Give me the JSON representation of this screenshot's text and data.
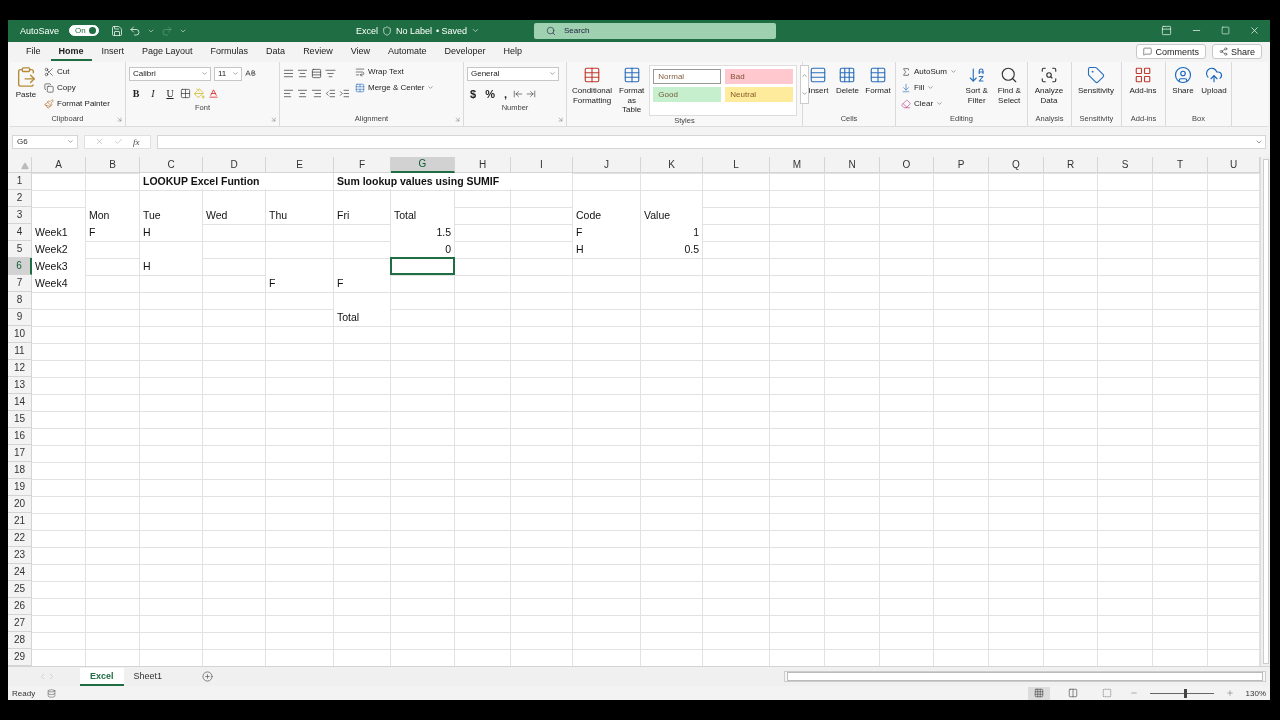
{
  "title_bar": {
    "autosave_label": "AutoSave",
    "autosave_on": true,
    "toggle_text": "On",
    "app": "Excel",
    "label": "No Label",
    "status": "• Saved",
    "search": {
      "placeholder": "Search"
    }
  },
  "menu_tabs": [
    {
      "label": "File",
      "selected": false
    },
    {
      "label": "Home",
      "selected": true
    },
    {
      "label": "Insert",
      "selected": false
    },
    {
      "label": "Page Layout",
      "selected": false
    },
    {
      "label": "Formulas",
      "selected": false
    },
    {
      "label": "Data",
      "selected": false
    },
    {
      "label": "Review",
      "selected": false
    },
    {
      "label": "View",
      "selected": false
    },
    {
      "label": "Automate",
      "selected": false
    },
    {
      "label": "Developer",
      "selected": false
    },
    {
      "label": "Help",
      "selected": false
    }
  ],
  "comments_button": "Comments",
  "share_button": "Share",
  "ribbon": {
    "clipboard": {
      "paste": "Paste",
      "cut": "Cut",
      "copy": "Copy",
      "format_painter": "Format Painter",
      "label": "Clipboard"
    },
    "font": {
      "name": "Calibri",
      "size": "11",
      "bold": "B",
      "italic": "I",
      "underline": "U",
      "label": "Font"
    },
    "alignment": {
      "wrap": "Wrap Text",
      "merge": "Merge & Center",
      "label": "Alignment"
    },
    "number": {
      "format": "General",
      "currency": "$",
      "percent": "%",
      "comma": ",",
      "label": "Number"
    },
    "styles": {
      "conditional": "Conditional Formatting",
      "format_table": "Format as Table",
      "items": [
        {
          "label": "Normal",
          "color": "#ffffff"
        },
        {
          "label": "Bad",
          "color": "#ffc7ce"
        },
        {
          "label": "Good",
          "color": "#c6efce"
        },
        {
          "label": "Neutral",
          "color": "#ffeb9c"
        }
      ],
      "label": "Styles"
    },
    "cells": {
      "buttons": [
        "Insert",
        "Delete",
        "Format"
      ],
      "label": "Cells"
    },
    "editing": {
      "autosum": "AutoSum",
      "fill": "Fill",
      "clear": "Clear",
      "sort": "Sort & Filter",
      "find": "Find & Select",
      "label": "Editing"
    },
    "analysis": {
      "button": "Analyze Data",
      "label": "Analysis"
    },
    "sensitivity": {
      "button": "Sensitivity",
      "label": "Sensitivity"
    },
    "addins": {
      "button": "Add-ins",
      "label": "Add-ins"
    },
    "box": {
      "share": "Share",
      "upload": "Upload",
      "label": "Box"
    }
  },
  "formula_bar": {
    "name_box": "G6",
    "fx": "fx"
  },
  "sheet": {
    "columns": [
      {
        "letter": "A",
        "selected": false
      },
      {
        "letter": "B",
        "selected": false
      },
      {
        "letter": "C",
        "selected": false
      },
      {
        "letter": "D",
        "selected": false
      },
      {
        "letter": "E",
        "selected": false
      },
      {
        "letter": "F",
        "selected": false
      },
      {
        "letter": "G",
        "selected": true
      },
      {
        "letter": "H",
        "selected": false
      },
      {
        "letter": "I",
        "selected": false
      },
      {
        "letter": "J",
        "selected": false
      },
      {
        "letter": "K",
        "selected": false
      },
      {
        "letter": "L",
        "selected": false
      },
      {
        "letter": "M",
        "selected": false
      },
      {
        "letter": "N",
        "selected": false
      },
      {
        "letter": "O",
        "selected": false
      },
      {
        "letter": "P",
        "selected": false
      },
      {
        "letter": "Q",
        "selected": false
      },
      {
        "letter": "R",
        "selected": false
      },
      {
        "letter": "S",
        "selected": false
      },
      {
        "letter": "T",
        "selected": false
      },
      {
        "letter": "U",
        "selected": false
      }
    ],
    "rows": [
      {
        "number": "1",
        "selected": false,
        "cells": [
          null,
          null,
          {
            "kind": "text",
            "text": "LOOKUP Excel Funtion",
            "bold": true,
            "selected": false
          },
          null,
          null,
          {
            "kind": "text",
            "text": "Sum lookup values using SUMIF",
            "bold": true,
            "selected": false
          }
        ]
      },
      {
        "number": "2",
        "selected": false
      },
      {
        "number": "3",
        "selected": false,
        "cells": [
          null,
          {
            "kind": "text",
            "text": "Mon",
            "bold": false,
            "selected": false
          },
          {
            "kind": "text",
            "text": "Tue",
            "bold": false,
            "selected": false
          },
          {
            "kind": "text",
            "text": "Wed",
            "bold": false,
            "selected": false
          },
          {
            "kind": "text",
            "text": "Thu",
            "bold": false,
            "selected": false
          },
          {
            "kind": "text",
            "text": "Fri",
            "bold": false,
            "selected": false
          },
          {
            "kind": "text",
            "text": "Total",
            "bold": false,
            "selected": false
          },
          null,
          null,
          {
            "kind": "text",
            "text": "Code",
            "bold": false,
            "selected": false
          },
          {
            "kind": "text",
            "text": "Value",
            "bold": false,
            "selected": false
          }
        ]
      },
      {
        "number": "4",
        "selected": false,
        "cells": [
          {
            "kind": "text",
            "text": "Week1",
            "bold": false,
            "selected": false
          },
          {
            "kind": "text",
            "text": "F",
            "bold": false,
            "selected": false
          },
          {
            "kind": "text",
            "text": "H",
            "bold": false,
            "selected": false
          },
          null,
          null,
          null,
          {
            "kind": "number",
            "text": "1.5",
            "bold": false,
            "selected": false
          },
          null,
          null,
          {
            "kind": "text",
            "text": "F",
            "bold": false,
            "selected": false
          },
          {
            "kind": "number",
            "text": "1",
            "bold": false,
            "selected": false
          }
        ]
      },
      {
        "number": "5",
        "selected": false,
        "cells": [
          {
            "kind": "text",
            "text": "Week2",
            "bold": false,
            "selected": false
          },
          null,
          null,
          null,
          null,
          null,
          {
            "kind": "number",
            "text": "0",
            "bold": false,
            "selected": false
          },
          null,
          null,
          {
            "kind": "text",
            "text": "H",
            "bold": false,
            "selected": false
          },
          {
            "kind": "number",
            "text": "0.5",
            "bold": false,
            "selected": false
          }
        ]
      },
      {
        "number": "6",
        "selected": true,
        "cells": [
          {
            "kind": "text",
            "text": "Week3",
            "bold": false,
            "selected": false
          },
          null,
          {
            "kind": "text",
            "text": "H",
            "bold": false,
            "selected": false
          },
          null,
          null,
          null,
          {
            "kind": "empty",
            "selected": true
          }
        ]
      },
      {
        "number": "7",
        "selected": false,
        "cells": [
          {
            "kind": "text",
            "text": "Week4",
            "bold": false,
            "selected": false
          },
          null,
          null,
          null,
          {
            "kind": "text",
            "text": "F",
            "bold": false,
            "selected": false
          },
          {
            "kind": "text",
            "text": "F",
            "bold": false,
            "selected": false
          }
        ]
      },
      {
        "number": "8",
        "selected": false
      },
      {
        "number": "9",
        "selected": false,
        "cells": [
          null,
          null,
          null,
          null,
          null,
          {
            "kind": "text",
            "text": "Total",
            "bold": false,
            "selected": false
          }
        ]
      },
      {
        "number": "10",
        "selected": false
      },
      {
        "number": "11",
        "selected": false
      },
      {
        "number": "12",
        "selected": false
      },
      {
        "number": "13",
        "selected": false
      },
      {
        "number": "14",
        "selected": false
      },
      {
        "number": "15",
        "selected": false
      },
      {
        "number": "16",
        "selected": false
      },
      {
        "number": "17",
        "selected": false
      },
      {
        "number": "18",
        "selected": false
      },
      {
        "number": "19",
        "selected": false
      },
      {
        "number": "20",
        "selected": false
      },
      {
        "number": "21",
        "selected": false
      },
      {
        "number": "22",
        "selected": false
      },
      {
        "number": "23",
        "selected": false
      },
      {
        "number": "24",
        "selected": false
      },
      {
        "number": "25",
        "selected": false
      },
      {
        "number": "26",
        "selected": false
      },
      {
        "number": "27",
        "selected": false
      },
      {
        "number": "28",
        "selected": false
      },
      {
        "number": "29",
        "selected": false
      }
    ]
  },
  "sheet_tabs": [
    {
      "label": "Excel",
      "selected": true
    },
    {
      "label": "Sheet1",
      "selected": false
    }
  ],
  "status_bar": {
    "status": "Ready",
    "views": [
      {
        "kind": "normal",
        "selected": true
      },
      {
        "kind": "page_layout",
        "selected": false
      },
      {
        "kind": "page_break",
        "selected": false
      }
    ],
    "zoom": {
      "level": 0.55,
      "reading": "130%"
    }
  }
}
